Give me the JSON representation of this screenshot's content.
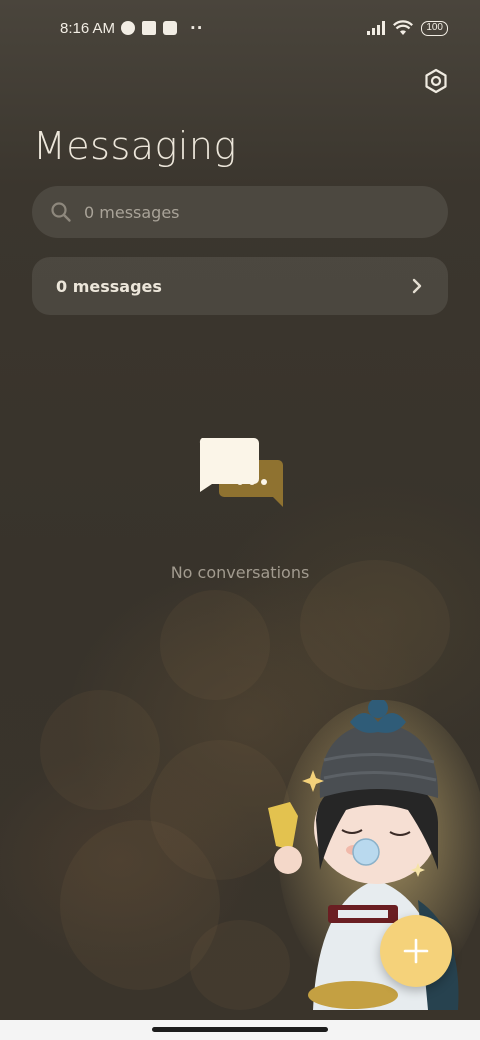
{
  "status_bar": {
    "time": "8:16 AM",
    "overflow": "··",
    "battery": "100"
  },
  "header": {
    "title": "Messaging"
  },
  "search": {
    "placeholder": "0 messages"
  },
  "messages_row": {
    "label": "0 messages"
  },
  "empty_state": {
    "text": "No conversations",
    "icon": "chat-bubbles-icon"
  },
  "colors": {
    "accent": "#f5d27a",
    "background": "#3a352d",
    "secondary_bubble": "#8f7230"
  },
  "icons": {
    "settings": "gear-icon",
    "search": "search-icon",
    "chevron": "chevron-right-icon",
    "compose": "plus-icon"
  }
}
